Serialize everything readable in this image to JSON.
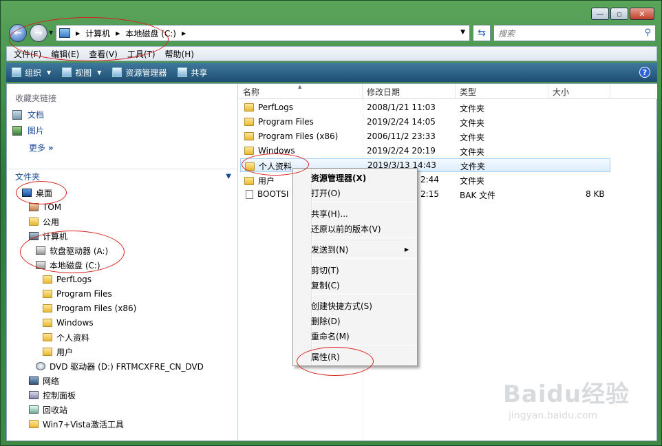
{
  "window": {
    "controls": {
      "minimize": "—",
      "maximize": "▫",
      "close": "✕"
    }
  },
  "address": {
    "crumbs": [
      "计算机",
      "本地磁盘 (C:)"
    ],
    "search_placeholder": "搜索"
  },
  "menu": [
    "文件(F)",
    "编辑(E)",
    "查看(V)",
    "工具(T)",
    "帮助(H)"
  ],
  "toolbar": {
    "organize": "组织",
    "views": "视图",
    "explorer": "资源管理器",
    "share": "共享"
  },
  "nav": {
    "favorites_header": "收藏夹链接",
    "favorites": [
      "文档",
      "图片"
    ],
    "more": "更多",
    "folders_header": "文件夹",
    "tree": [
      {
        "label": "桌面",
        "icon": "desk"
      },
      {
        "label": "TOM",
        "icon": "user"
      },
      {
        "label": "公用",
        "icon": "folder"
      },
      {
        "label": "计算机",
        "icon": "comp"
      },
      {
        "label": "软盘驱动器 (A:)",
        "icon": "drive"
      },
      {
        "label": "本地磁盘 (C:)",
        "icon": "drive"
      },
      {
        "label": "PerfLogs",
        "icon": "folder"
      },
      {
        "label": "Program Files",
        "icon": "folder"
      },
      {
        "label": "Program Files (x86)",
        "icon": "folder"
      },
      {
        "label": "Windows",
        "icon": "folder"
      },
      {
        "label": "个人资料",
        "icon": "folder"
      },
      {
        "label": "用户",
        "icon": "folder"
      },
      {
        "label": "DVD 驱动器 (D:) FRTMCXFRE_CN_DVD",
        "icon": "dvd"
      },
      {
        "label": "网络",
        "icon": "net"
      },
      {
        "label": "控制面板",
        "icon": "ctrlp"
      },
      {
        "label": "回收站",
        "icon": "bin"
      },
      {
        "label": "Win7+Vista激活工具",
        "icon": "folder"
      }
    ]
  },
  "files": {
    "columns": [
      "名称",
      "修改日期",
      "类型",
      "大小"
    ],
    "rows": [
      {
        "name": "PerfLogs",
        "date": "2008/1/21 11:03",
        "type": "文件夹",
        "size": ""
      },
      {
        "name": "Program Files",
        "date": "2019/2/24 14:05",
        "type": "文件夹",
        "size": ""
      },
      {
        "name": "Program Files (x86)",
        "date": "2006/11/2 23:33",
        "type": "文件夹",
        "size": ""
      },
      {
        "name": "Windows",
        "date": "2019/2/24 20:19",
        "type": "文件夹",
        "size": ""
      },
      {
        "name": "个人资料",
        "date": "2019/3/13 14:43",
        "type": "文件夹",
        "size": ""
      },
      {
        "name": "用户",
        "date": "2:44",
        "type": "文件夹",
        "size": ""
      },
      {
        "name": "BOOTSI",
        "date": "2:15",
        "type": "BAK 文件",
        "size": "8 KB"
      }
    ]
  },
  "context_menu": {
    "items": [
      "资源管理器(X)",
      "打开(O)",
      "共享(H)...",
      "还原以前的版本(V)",
      "发送到(N)",
      "剪切(T)",
      "复制(C)",
      "创建快捷方式(S)",
      "删除(D)",
      "重命名(M)",
      "属性(R)"
    ]
  },
  "watermark": {
    "brand": "Baidu经验",
    "url": "jingyan.baidu.com"
  }
}
